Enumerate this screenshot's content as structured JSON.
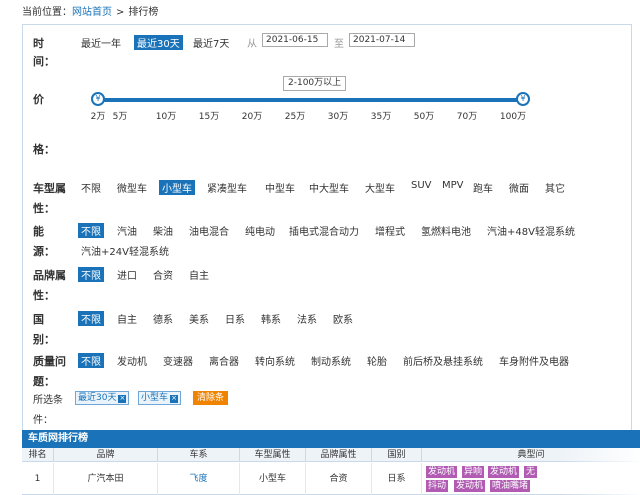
{
  "breadcrumb": {
    "prefix": "当前位置：",
    "home": "网站首页",
    "sep": ">",
    "current": "排行榜"
  },
  "time": {
    "label_1": "时",
    "label_2": "间：",
    "options": [
      "最近一年",
      "最近30天",
      "最近7天"
    ],
    "selected": "最近30天",
    "from_label": "从",
    "start_date": "2021-06-15",
    "to_label": "至",
    "end_date": "2021-07-14"
  },
  "price": {
    "label_1": "价",
    "label_2": "格：",
    "range_tip": "2-100万以上",
    "handle_glyph": "¥",
    "ticks": [
      "2万",
      "5万",
      "10万",
      "15万",
      "20万",
      "25万",
      "30万",
      "35万",
      "50万",
      "70万",
      "100万"
    ],
    "low_fraction": 0,
    "high_fraction": 1
  },
  "vehicle_type": {
    "label_1": "车型属",
    "label_2": "性：",
    "options": [
      "不限",
      "微型车",
      "小型车",
      "紧凑型车",
      "中型车",
      "中大型车",
      "大型车",
      "SUV",
      "MPV",
      "跑车",
      "微面",
      "其它"
    ],
    "selected": "小型车"
  },
  "energy": {
    "label_1": "能",
    "label_2": "源：",
    "options": [
      "不限",
      "汽油",
      "柴油",
      "油电混合",
      "纯电动",
      "插电式混合动力",
      "增程式",
      "氢燃料电池",
      "汽油+48V轻混系统"
    ],
    "options_row2": [
      "汽油+24V轻混系统"
    ],
    "selected": "不限"
  },
  "brand_attr": {
    "label_1": "品牌属",
    "label_2": "性：",
    "options": [
      "不限",
      "进口",
      "合资",
      "自主"
    ],
    "selected": "不限"
  },
  "country": {
    "label_1": "国",
    "label_2": "别：",
    "options": [
      "不限",
      "自主",
      "德系",
      "美系",
      "日系",
      "韩系",
      "法系",
      "欧系"
    ],
    "selected": "不限"
  },
  "quality": {
    "label_1": "质量问",
    "label_2": "题：",
    "options": [
      "不限",
      "发动机",
      "变速器",
      "离合器",
      "转向系统",
      "制动系统",
      "轮胎",
      "前后桥及悬挂系统",
      "车身附件及电器"
    ],
    "selected": "不限"
  },
  "chosen": {
    "label_1": "所选条",
    "label_2": "件：",
    "chips": [
      "最近30天",
      "小型车"
    ],
    "chip_close": "×",
    "clear": "清除条"
  },
  "ranking": {
    "title": "车质网排行榜",
    "headers": [
      "排名",
      "品牌",
      "车系",
      "车型属性",
      "品牌属性",
      "国别",
      "典型问"
    ],
    "rows": [
      {
        "rank": "1",
        "brand": "广汽本田",
        "series": "飞度",
        "vehicle_attr": "小型车",
        "brand_attr": "合资",
        "country": "日系",
        "issues_row1": [
          "发动机",
          "异响",
          "发动机",
          "无"
        ],
        "issues_row2": [
          "抖动",
          "发动机",
          "喷油嘴堵"
        ]
      }
    ]
  },
  "colors": {
    "accent": "#1a73b8",
    "issue": "#b15bb3",
    "clear": "#f08300"
  }
}
